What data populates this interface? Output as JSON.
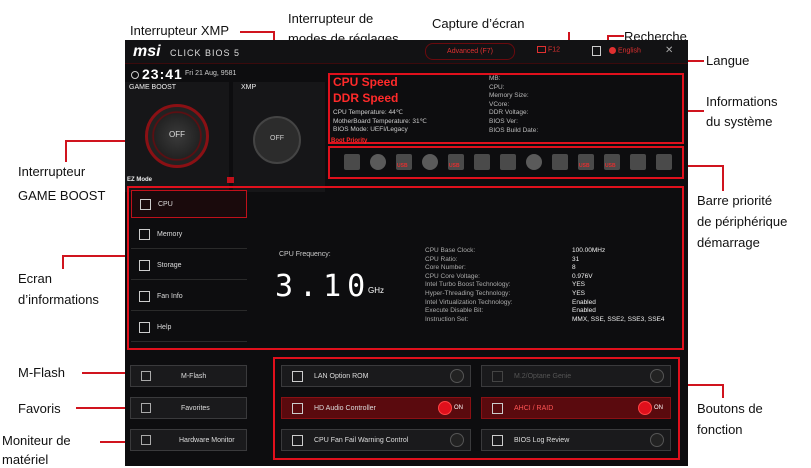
{
  "callouts": {
    "xmp_switch": "Interrupteur XMP",
    "mode_switch_1": "Interrupteur de",
    "mode_switch_2": "modes de réglages",
    "screenshot": "Capture d’écran",
    "search": "Recherche",
    "language": "Langue",
    "sysinfo_1": "Informations",
    "sysinfo_2": "du système",
    "gameboost_1": "Interrupteur",
    "gameboost_2": "GAME BOOST",
    "boot_1": "Barre priorité",
    "boot_2": "de périphérique",
    "boot_3": "démarrage",
    "info_screen_1": "Ecran",
    "info_screen_2": "d’informations",
    "mflash": "M-Flash",
    "favorites": "Favoris",
    "hwmon_1": "Moniteur de",
    "hwmon_2": "matériel",
    "function_1": "Boutons de",
    "function_2": "fonction"
  },
  "bios": {
    "brand": "msi",
    "brand_sub": "CLICK BIOS 5",
    "mode_label": "Advanced (F7)",
    "screenshot_key": "F12",
    "language_label": "English",
    "time": "23:41",
    "date": "Fri 21 Aug, 9581",
    "game_boost_label": "GAME BOOST",
    "xmp_label": "XMP",
    "off_label": "OFF",
    "cpu_speed": "CPU Speed",
    "ddr_speed": "DDR Speed",
    "cpu_temp": "CPU Temperature: 44℃",
    "mb_temp": "MotherBoard Temperature: 31℃",
    "bios_mode": "BIOS Mode: UEFI/Legacy",
    "boot_priority": "Boot Priority",
    "sys_labels": [
      "MB:",
      "CPU:",
      "Memory Size:",
      "VCore:",
      "DDR Voltage:",
      "BIOS Ver:",
      "BIOS Build Date:"
    ],
    "ez_mode": "EZ Mode",
    "menu": [
      {
        "label": "CPU",
        "icon": "cpu-icon"
      },
      {
        "label": "Memory",
        "icon": "memory-icon"
      },
      {
        "label": "Storage",
        "icon": "storage-icon"
      },
      {
        "label": "Fan Info",
        "icon": "fan-icon"
      },
      {
        "label": "Help",
        "icon": "help-icon"
      }
    ],
    "cpu_freq_label": "CPU Frequency:",
    "cpu_freq_value": "3.10",
    "cpu_freq_unit": "GHz",
    "cpu_specs": [
      {
        "k": "CPU Base Clock:",
        "v": "100.00MHz"
      },
      {
        "k": "CPU Ratio:",
        "v": "31"
      },
      {
        "k": "Core Number:",
        "v": "8"
      },
      {
        "k": "CPU Core Voltage:",
        "v": "0.976V"
      },
      {
        "k": "Intel Turbo Boost Technology:",
        "v": "YES"
      },
      {
        "k": "Hyper-Threading Technology:",
        "v": "YES"
      },
      {
        "k": "Intel Virtualization Technology:",
        "v": "Enabled"
      },
      {
        "k": "Execute Disable Bit:",
        "v": "Enabled"
      },
      {
        "k": "Instruction Set:",
        "v": "MMX, SSE, SSE2, SSE3, SSE4"
      }
    ],
    "left_buttons": [
      "M-Flash",
      "Favorites",
      "Hardware Monitor"
    ],
    "functions": [
      {
        "label": "LAN Option ROM",
        "on": false
      },
      {
        "label": "M.2/Optane Genie",
        "on": false
      },
      {
        "label": "HD Audio Controller",
        "on": true
      },
      {
        "label": "AHCI / RAID",
        "on": true
      },
      {
        "label": "CPU Fan Fail Warning Control",
        "on": false
      },
      {
        "label": "BIOS Log Review",
        "on": false
      }
    ],
    "on_label": "ON",
    "usb_label": "USB"
  }
}
